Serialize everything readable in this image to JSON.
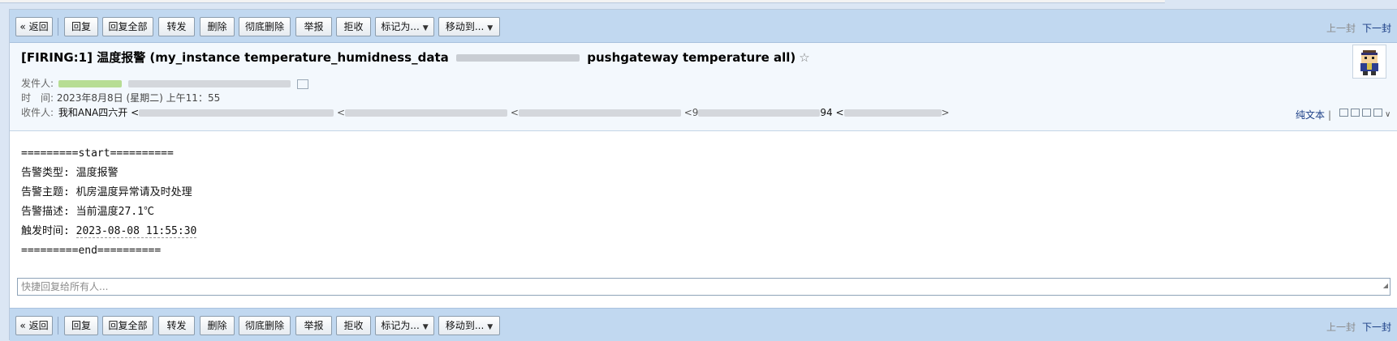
{
  "toolbar": {
    "back": "« 返回",
    "reply": "回复",
    "reply_all": "回复全部",
    "forward": "转发",
    "delete": "删除",
    "delete_permanently": "彻底删除",
    "report": "举报",
    "reject": "拒收",
    "mark_as": "标记为...",
    "move_to": "移动到...",
    "prev": "上一封",
    "next": "下一封"
  },
  "email": {
    "subject_pre": "[FIRING:1] 温度报警 (my_instance temperature_humidness_data",
    "subject_post": "pushgateway temperature all)",
    "star": "☆",
    "sender_label": "发件人:",
    "time_label": "时　间:",
    "time_value": "2023年8月8日 (星期二) 上午11：55",
    "recipients_label": "收件人:",
    "recipients_first": "我和ANA四六开 <",
    "recipients_mid_a": " <",
    "recipients_mid_b": " <",
    "recipients_mid_c": " <9",
    "recipients_94": "94 <",
    "recipients_end": ">",
    "plain_text": "纯文本",
    "plain_sep": "|"
  },
  "body": {
    "start": "=========start==========",
    "type_label": "告警类型: ",
    "type_value": "温度报警",
    "topic_label": "告警主题: ",
    "topic_value": "机房温度异常请及时处理",
    "desc_label": "告警描述: ",
    "desc_value": "当前温度27.1℃",
    "time_label": "触发时间: ",
    "time_value": "2023-08-08 11:55:30",
    "end": "=========end=========="
  },
  "quick_reply": {
    "placeholder": "快捷回复给所有人..."
  },
  "icons": {
    "star": "star-outline-icon",
    "dropdown": "caret-down-icon",
    "header_tools": [
      "new-window-icon",
      "note-icon",
      "file-icon",
      "print-icon",
      "chevron-down-icon"
    ]
  }
}
